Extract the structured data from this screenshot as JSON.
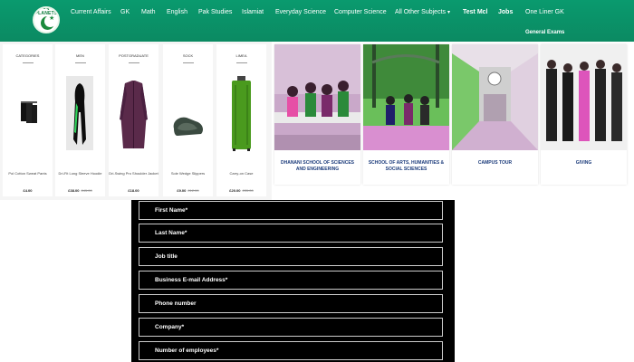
{
  "header": {
    "logo_text": "MCQ's PLANETS",
    "menu": [
      "Current Affairs",
      "GK",
      "Math",
      "English",
      "Pak Studies",
      "Islamiat",
      "Everyday Science",
      "Computer Science",
      "All Other Subjects",
      "Test Mcl",
      "Jobs",
      "One Liner GK"
    ],
    "general_exams": "General Exams",
    "colors": {
      "nav": "#0b8a62",
      "link": "#ffffff"
    }
  },
  "products": [
    {
      "title": "CATEGORIES",
      "name": "Pol Cotton Sweat Pants",
      "price": "£4.00",
      "old_price": ""
    },
    {
      "title": "MEN",
      "name": "Dri-Fit Long Sleeve Hoodie",
      "price": "£38.00",
      "old_price": "£45.00"
    },
    {
      "title": "POSTGRADUATE",
      "name": "Dri-Swing Pro Shoulder Jacket",
      "price": "£18.00",
      "old_price": ""
    },
    {
      "title": "SOCK",
      "name": "Sole Wedge Slippers",
      "price": "£9.00",
      "old_price": "£12.00"
    },
    {
      "title": "LIMEA",
      "name": "Carry-on Case",
      "price": "£20.00",
      "old_price": "£35.00"
    }
  ],
  "schools": [
    {
      "label": "DHANANI SCHOOL OF SCIENCES AND ENGINEERING"
    },
    {
      "label": "SCHOOL OF ARTS, HUMANITIES & SOCIAL SCIENCES"
    },
    {
      "label": "CAMPUS TOUR"
    },
    {
      "label": "GIVING"
    }
  ],
  "form": {
    "fields": [
      "First Name*",
      "Last Name*",
      "Job title",
      "Business E-mail Address*",
      "Phone number",
      "Company*",
      "Number of employees*"
    ]
  }
}
